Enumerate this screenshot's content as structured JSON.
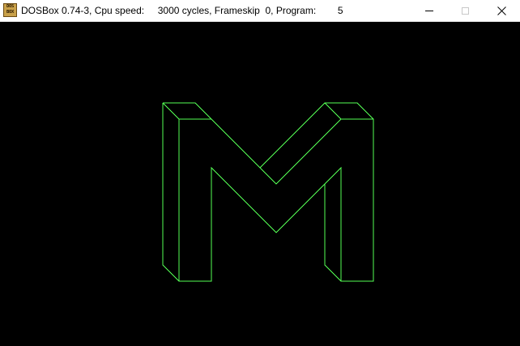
{
  "window": {
    "title": "DOSBox 0.74-3, Cpu speed:     3000 cycles, Frameskip  0, Program:        5",
    "icon_lines": [
      "DOS",
      "BOX"
    ],
    "icon": "dosbox-icon",
    "controls": {
      "minimize_icon": "minimize-icon",
      "maximize_icon": "maximize-icon",
      "close_icon": "close-icon"
    }
  },
  "screen": {
    "background": "#000000",
    "line_color": "#55ff55",
    "graphic": "wireframe-letter-m"
  }
}
